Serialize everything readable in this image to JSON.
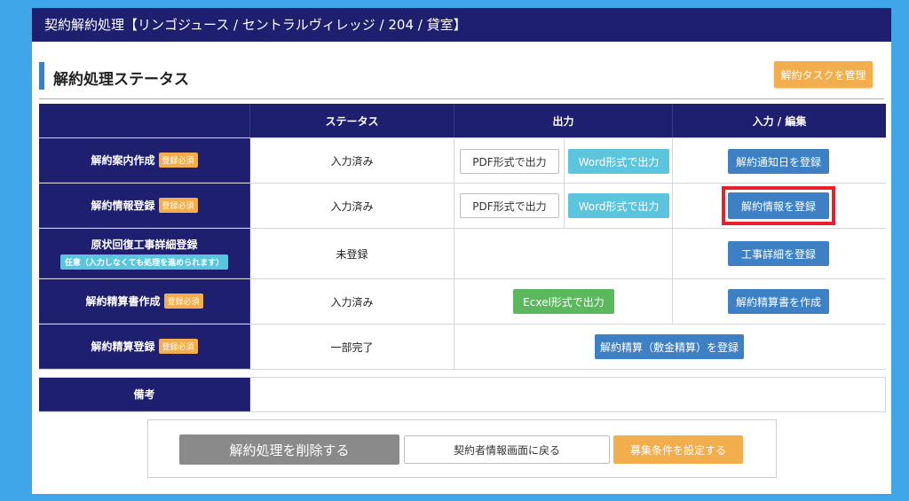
{
  "window": {
    "title": "契約解約処理【リンゴジュース / セントラルヴィレッジ / 204 / 貸室】"
  },
  "section": {
    "title": "解約処理ステータス",
    "manage_task_label": "解約タスクを管理"
  },
  "table": {
    "headers": [
      "",
      "ステータス",
      "出力",
      "入力 / 編集"
    ],
    "rows": [
      {
        "label": "解約案内作成",
        "badge": "登録必須",
        "status": "入力済み",
        "pdf": "PDF形式で出力",
        "word": "Word形式で出力",
        "action": "解約通知日を登録"
      },
      {
        "label": "解約情報登録",
        "badge": "登録必須",
        "status": "入力済み",
        "pdf": "PDF形式で出力",
        "word": "Word形式で出力",
        "action": "解約情報を登録"
      },
      {
        "label": "原状回復工事詳細登録",
        "badge": "任意（入力しなくても処理を進められます）",
        "status": "未登録",
        "action": "工事詳細を登録"
      },
      {
        "label": "解約精算書作成",
        "badge": "登録必須",
        "status": "入力済み",
        "excel": "Ecxel形式で出力",
        "action": "解約精算書を作成"
      },
      {
        "label": "解約精算登録",
        "badge": "登録必須",
        "status": "一部完了",
        "action": "解約精算（敷金精算）を登録"
      }
    ],
    "remarks_label": "備考"
  },
  "footer": {
    "delete_label": "解約処理を削除する",
    "back_label": "契約者情報画面に戻る",
    "recruit_label": "募集条件を設定する"
  },
  "colors": {
    "navy": "#1e1f6e",
    "blue": "#3d80c4",
    "cyan": "#5bc5de",
    "orange": "#f2ad4c",
    "green": "#5cb85c",
    "highlight": "#e8202b"
  }
}
